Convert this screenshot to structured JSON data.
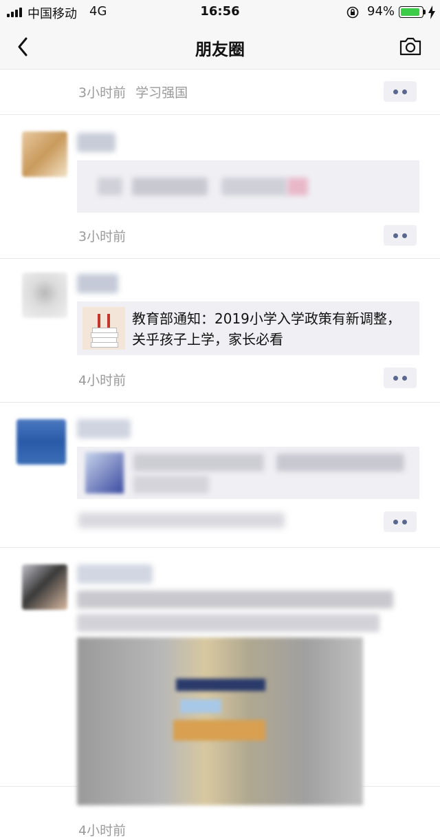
{
  "status_bar": {
    "carrier": "中国移动",
    "network": "4G",
    "time": "16:56",
    "battery_percent": "94%",
    "battery_level": 0.94
  },
  "navbar": {
    "title": "朋友圈",
    "back_icon": "chevron-left-icon",
    "camera_icon": "camera-icon"
  },
  "posts": [
    {
      "time": "3小时前",
      "source": "学习强国"
    },
    {
      "time": "3小时前"
    },
    {
      "time": "4小时前",
      "article": {
        "title": "教育部通知：2019小学入学政策有新调整，关乎孩子上学，家长必看"
      }
    },
    {
      "time": ""
    },
    {
      "time": "4小时前"
    }
  ],
  "colors": {
    "link_blue": "#5a6890",
    "timestamp_gray": "#9a9a9a",
    "battery_green": "#3ccc4a",
    "content_bg": "#f0f0f4"
  }
}
